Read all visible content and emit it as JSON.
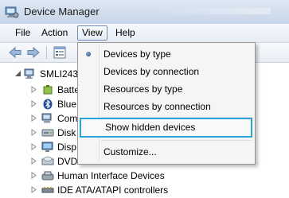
{
  "window": {
    "title": "Device Manager"
  },
  "menubar": {
    "file": "File",
    "action": "Action",
    "view": "View",
    "help": "Help"
  },
  "view_menu": {
    "items": [
      {
        "label": "Devices by type",
        "selected": true
      },
      {
        "label": "Devices by connection"
      },
      {
        "label": "Resources by type"
      },
      {
        "label": "Resources by connection"
      },
      {
        "label": "Show hidden devices",
        "highlighted": true
      },
      {
        "label": "Customize..."
      }
    ]
  },
  "tree": {
    "root": "SMLI243",
    "nodes": [
      {
        "label": "Batte",
        "icon": "battery-icon"
      },
      {
        "label": "Blue",
        "icon": "bluetooth-icon"
      },
      {
        "label": "Com",
        "icon": "computer-icon"
      },
      {
        "label": "Disk",
        "icon": "disk-drive-icon"
      },
      {
        "label": "Disp",
        "icon": "display-adapter-icon"
      },
      {
        "label": "DVD",
        "icon": "dvd-drive-icon"
      },
      {
        "label": "Human Interface Devices",
        "icon": "hid-icon"
      },
      {
        "label": "IDE ATA/ATAPI controllers",
        "icon": "ide-controller-icon"
      }
    ]
  },
  "colors": {
    "highlight_border": "#2aa5d9",
    "menu_bg": "#f5f5f5",
    "title_gradient_top": "#dfe8f3"
  }
}
